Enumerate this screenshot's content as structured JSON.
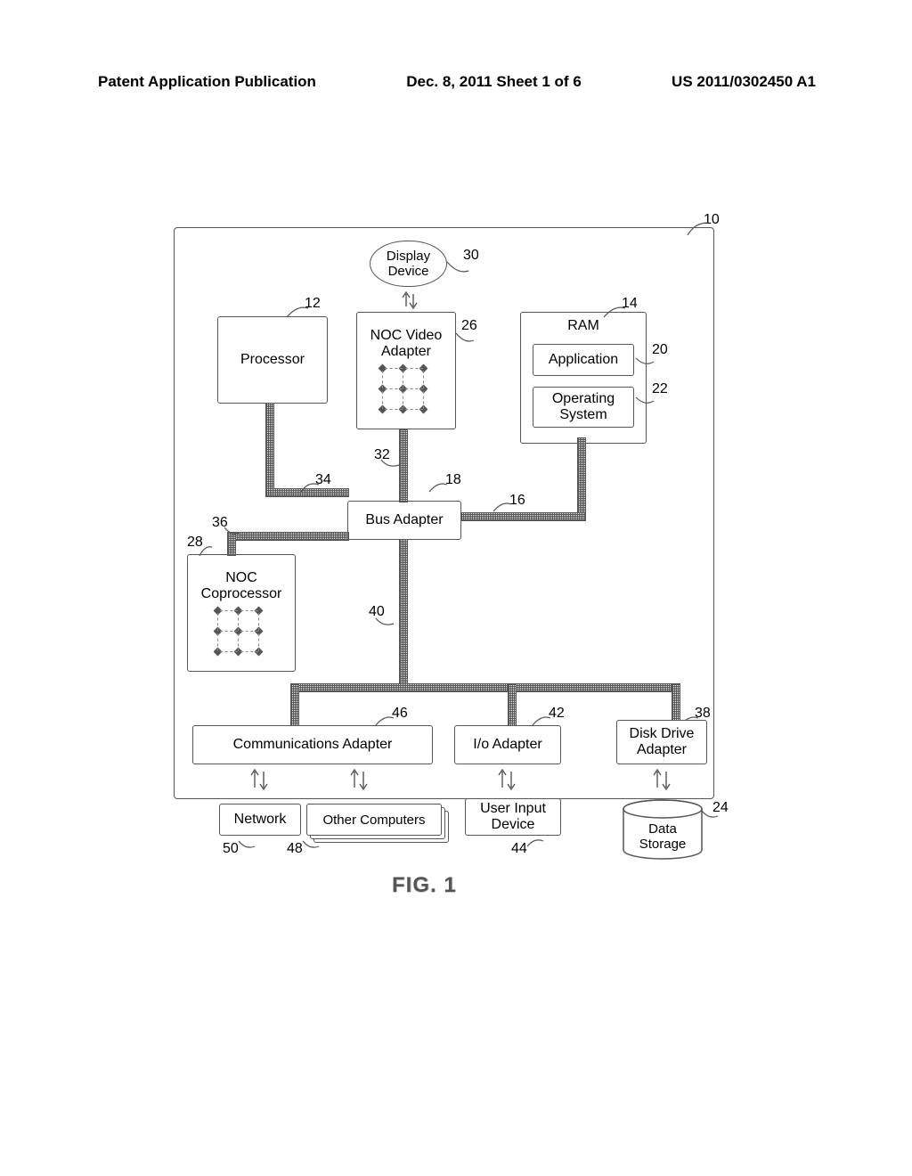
{
  "header": {
    "left": "Patent Application Publication",
    "center": "Dec. 8, 2011  Sheet 1 of 6",
    "right": "US 2011/0302450 A1"
  },
  "refs": {
    "system": "10",
    "processor": "12",
    "ram": "14",
    "fsb": "16",
    "busLink": "18",
    "application": "20",
    "os": "22",
    "dataStorage": "24",
    "videoAdapter": "26",
    "coprocessor": "28",
    "displayDevice": "30",
    "memBus": "32",
    "videoBus": "34",
    "extBus": "36",
    "diskDriveAdapter": "38",
    "expBus": "40",
    "ioAdapter": "42",
    "userInput": "44",
    "commAdapter": "46",
    "otherComputers": "48",
    "network": "50"
  },
  "blocks": {
    "displayDevice": "Display\nDevice",
    "nocVideoAdapter": "NOC Video\nAdapter",
    "processor": "Processor",
    "ram": "RAM",
    "application": "Application",
    "operatingSystem": "Operating\nSystem",
    "busAdapter": "Bus Adapter",
    "nocCoprocessor": "NOC\nCoprocessor",
    "commAdapter": "Communications Adapter",
    "ioAdapter": "I/o Adapter",
    "diskDriveAdapter": "Disk Drive\nAdapter",
    "network": "Network",
    "otherComputers": "Other Computers",
    "userInput": "User Input\nDevice",
    "dataStorage": "Data\nStorage"
  },
  "figure": "FIG. 1"
}
